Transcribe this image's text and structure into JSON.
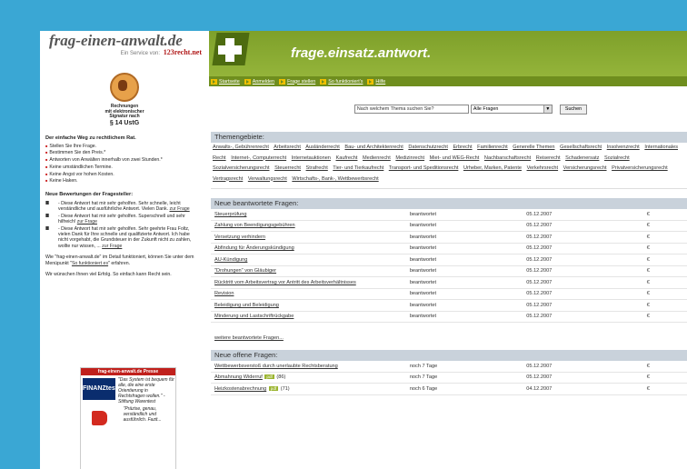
{
  "left": {
    "logo": "frag-einen-anwalt.de",
    "service_label": "Ein Service von:",
    "service_brand": "123recht.net",
    "seal_text": [
      "Rechnungen",
      "mit elektronischer",
      "Signatur nach"
    ],
    "seal_big": "§ 14 UstG",
    "heading1": "Der einfache Weg zu rechtlichem Rat.",
    "steps": [
      "Stellen Sie Ihre Frage.",
      "Bestimmen Sie den Preis.*",
      "Antworten von Anwälten innerhalb von zwei Stunden.*"
    ],
    "assurances": [
      "Keine umständlichen Termine.",
      "Keine Angst vor hohen Kosten.",
      "Keine Haken."
    ],
    "heading2": "Neue Bewertungen der Fragesteller:",
    "reviews": [
      {
        "stars": "IIIIIII",
        "text": "- Diese Antwort hat mir sehr geholfen. Sehr schnelle, leicht verständliche und ausführliche Antwort. Vielen Dank.",
        "link": "zur Frage"
      },
      {
        "stars": "IIIIIII",
        "text": "- Diese Antwort hat mir sehr geholfen. Superschnell und sehr hilfreich!",
        "link": "zur Frage"
      },
      {
        "stars": "IIIIIII",
        "text": "- Diese Antwort hat mir sehr geholfen. Sehr geehrte Frau Foltz, vielen Dank für Ihre schnelle und qualifizierte Antwort. Ich habe nicht vorgehabt, die Grundsteuer in der Zukunft nicht zu zahlen, wollte nur wissen, ...",
        "link": "zur Frage"
      }
    ],
    "info1_pre": "Wie \"frag-einen-anwalt.de\" im Detail funktioniert, können Sie unter dem Menüpunkt \"",
    "info1_link": "So funktioniert es",
    "info1_post": "\" erfahren.",
    "info2": "Wir wünschen Ihnen viel Erfolg. So einfach kann Recht sein.",
    "promo": {
      "header": "frag-einen-anwalt.de Presse",
      "logo1": "FINANZtest",
      "quote1": "\"Das System ist bequem für alle, die eine erste Orientierung in Rechtsfragen wollen.\" - Stiftung Warentest",
      "quote2": "\"Präzise, genau, verständlich und ausführlich. Fazit..."
    }
  },
  "header": {
    "site_title": "frage.einsatz.antwort."
  },
  "nav": [
    "Startseite",
    "Anmelden",
    "Frage stellen",
    "So funktioniert's",
    "Hilfe"
  ],
  "search": {
    "placeholder": "Nach welchem Thema suchen Sie?",
    "select": "Alle Fragen",
    "button": "Suchen"
  },
  "themes": {
    "title": "Themengebiete:",
    "items": [
      "Anwalts-, Gebührenrecht",
      "Arbeitsrecht",
      "Ausländerrecht",
      "Bau- und Architektenrecht",
      "Datenschutzrecht",
      "Erbrecht",
      "Familienrecht",
      "Generelle Themen",
      "Gesellschaftsrecht",
      "Insolvenzrecht",
      "Internationales Recht",
      "Internet-, Computerrecht",
      "Internetauktionen",
      "Kaufrecht",
      "Medienrecht",
      "Medizinrecht",
      "Miet- und WEG-Recht",
      "Nachbarschaftsrecht",
      "Reiserecht",
      "Schadenersatz",
      "Sozialrecht",
      "Sozialversicherungsrecht",
      "Steuerrecht",
      "Strafrecht",
      "Tier- und Tierkaufrecht",
      "Transport- und Speditionsrecht",
      "Urheber, Marken, Patente",
      "Verkehrsrecht",
      "Versicherungsrecht",
      "Privatversicherungsrecht",
      "Vertragsrecht",
      "Verwaltungsrecht",
      "Wirtschafts-, Bank-, Wettbewerbsrecht"
    ]
  },
  "answered": {
    "title": "Neue beantwortete Fragen:",
    "rows": [
      {
        "q": "Steuerprüfung",
        "status": "beantwortet",
        "date": "05.12.2007",
        "price": "€"
      },
      {
        "q": "Zahlung von Beendigungsgebühren",
        "status": "beantwortet",
        "date": "05.12.2007",
        "price": "€"
      },
      {
        "q": "Versetzung verhindern",
        "status": "beantwortet",
        "date": "05.12.2007",
        "price": "€"
      },
      {
        "q": "Abfindung für Änderungskündigung",
        "status": "beantwortet",
        "date": "05.12.2007",
        "price": "€"
      },
      {
        "q": "AU-Kündigung",
        "status": "beantwortet",
        "date": "05.12.2007",
        "price": "€"
      },
      {
        "q": "\"Drohungen\" von Gläubiger",
        "status": "beantwortet",
        "date": "05.12.2007",
        "price": "€"
      },
      {
        "q": "Rücktritt vom Arbeitsvertrag vor Antritt des Arbeitsverhältnisses",
        "status": "beantwortet",
        "date": "05.12.2007",
        "price": "€"
      },
      {
        "q": "Revision",
        "status": "beantwortet",
        "date": "05.12.2007",
        "price": "€"
      },
      {
        "q": "Beleidigung und Beleidigung",
        "status": "beantwortet",
        "date": "05.12.2007",
        "price": "€"
      },
      {
        "q": "Minderung und Lastschriftrückgabe",
        "status": "beantwortet",
        "date": "05.12.2007",
        "price": "€"
      }
    ],
    "more": "weitere beantwortete Fragen..."
  },
  "open": {
    "title": "Neue offene Fragen:",
    "rows": [
      {
        "q": "Wettbewerbsverstoß durch unerlaubte Rechtsberatung",
        "badge": "",
        "count": "",
        "status": "noch 7 Tage",
        "date": "05.12.2007",
        "price": "€"
      },
      {
        "q": "Abmahnung Widerruf",
        "badge": "pdf",
        "count": "(86)",
        "status": "noch 7 Tage",
        "date": "05.12.2007",
        "price": "€"
      },
      {
        "q": "Heizkostenabrechnung",
        "badge": "pdf",
        "count": "(71)",
        "status": "noch 6 Tage",
        "date": "04.12.2007",
        "price": "€"
      }
    ]
  }
}
